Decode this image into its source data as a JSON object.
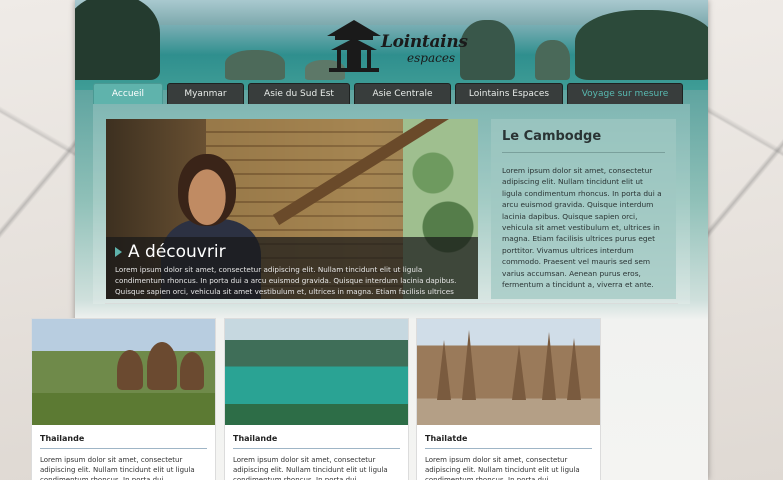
{
  "logo": {
    "line1": "Lointains",
    "line2": "espaces"
  },
  "nav": {
    "tabs": [
      {
        "label": "Accueil"
      },
      {
        "label": "Myanmar"
      },
      {
        "label": "Asie du Sud Est"
      },
      {
        "label": "Asie Centrale"
      },
      {
        "label": "Lointains Espaces"
      },
      {
        "label": "Voyage sur mesure"
      }
    ]
  },
  "hero": {
    "title": "A découvrir",
    "text": "Lorem ipsum dolor sit amet, consectetur adipiscing elit. Nullam tincidunt elit ut ligula condimentum rhoncus. In porta dui a arcu euismod gravida. Quisque interdum lacinia dapibus. Quisque sapien orci, vehicula sit amet vestibulum et, ultrices in magna. Etiam facilisis ultrices purus eget porttitor."
  },
  "sidebar": {
    "title": "Le Cambodge",
    "text": "Lorem ipsum dolor sit amet, consectetur adipiscing elit. Nullam tincidunt elit ut ligula condimentum rhoncus. In porta dui a arcu euismod gravida. Quisque interdum lacinia dapibus. Quisque sapien orci, vehicula sit amet vestibulum et, ultrices in magna. Etiam facilisis ultrices purus eget porttitor. Vivamus ultrices interdum commodo. Praesent vel mauris sed sem varius accumsan. Aenean purus eros, fermentum a tincidunt a, viverra et ante."
  },
  "cards": [
    {
      "title": "Thailande",
      "text": "Lorem ipsum dolor sit amet, consectetur adipiscing elit. Nullam tincidunt elit ut ligula condimentum rhoncus. In porta dui"
    },
    {
      "title": "Thailande",
      "text": "Lorem ipsum dolor sit amet, consectetur adipiscing elit. Nullam tincidunt elit ut ligula condimentum rhoncus. In porta dui"
    },
    {
      "title": "Thailatde",
      "text": "Lorem ipsum dolor sit amet, consectetur adipiscing elit. Nullam tincidunt elit ut ligula condimentum rhoncus. In porta dui"
    }
  ],
  "colors": {
    "accent": "#5fb3ac",
    "nav_bg": "#383d3c",
    "sidebar_bg": "#a0c8c2"
  }
}
